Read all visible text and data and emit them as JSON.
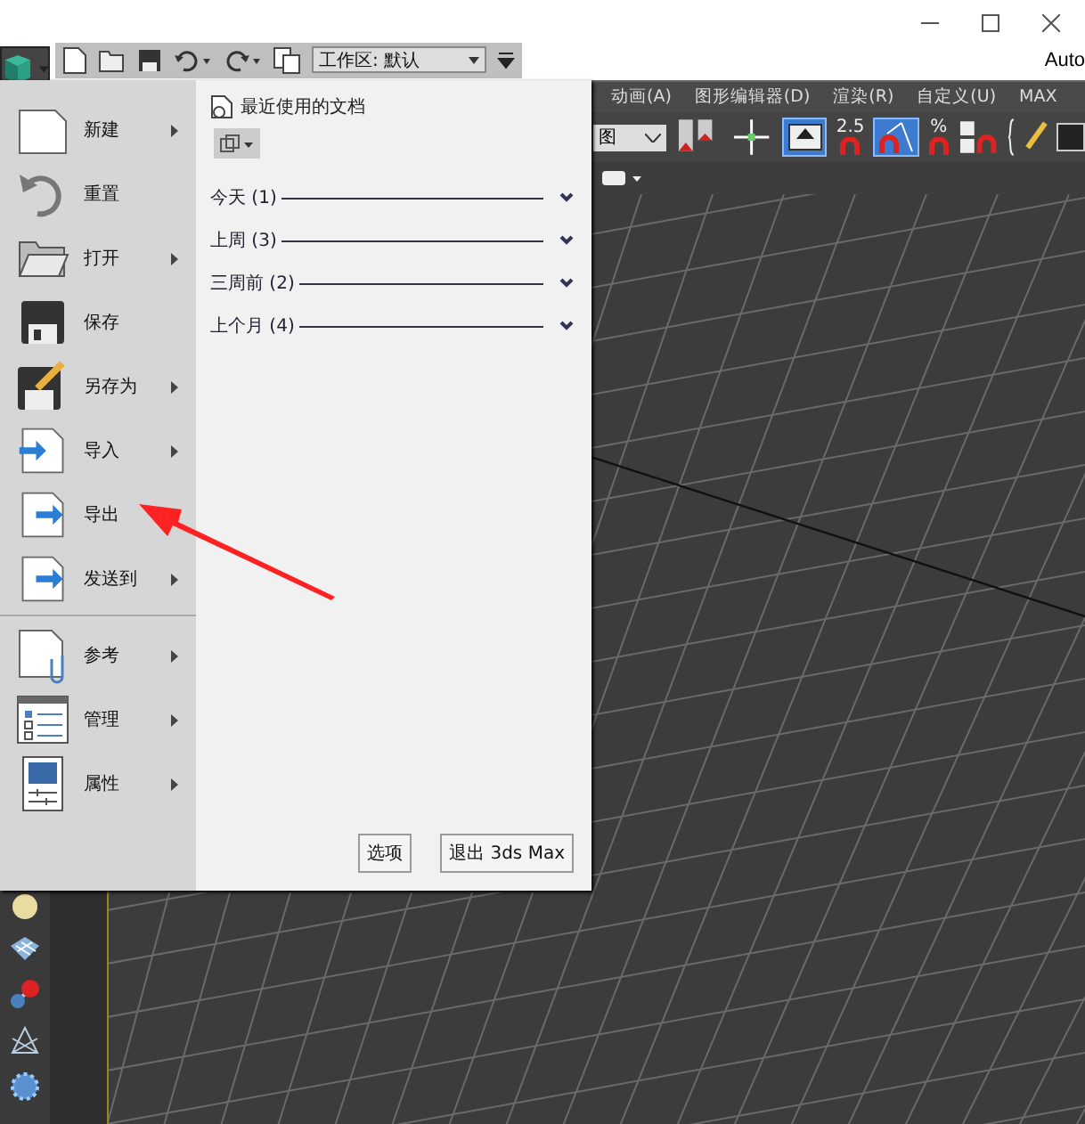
{
  "window": {
    "title": "Auto"
  },
  "quick_access": {
    "workspace_label": "工作区: 默认"
  },
  "menu_bar": [
    "动画(A)",
    "图形编辑器(D)",
    "渲染(R)",
    "自定义(U)",
    "MAX"
  ],
  "toolbar": {
    "view_dropdown": "图",
    "snap_angle_label": "2.5",
    "percent_snap_label": "%"
  },
  "app_menu": {
    "items": [
      {
        "kind": "new",
        "label": "新建",
        "submenu": true
      },
      {
        "kind": "reset",
        "label": "重置",
        "submenu": false
      },
      {
        "kind": "open",
        "label": "打开",
        "submenu": true
      },
      {
        "kind": "save",
        "label": "保存",
        "submenu": false
      },
      {
        "kind": "saveas",
        "label": "另存为",
        "submenu": true
      },
      {
        "kind": "import",
        "label": "导入",
        "submenu": true
      },
      {
        "kind": "export",
        "label": "导出",
        "submenu": false
      },
      {
        "kind": "send",
        "label": "发送到",
        "submenu": true
      },
      {
        "kind": "divider"
      },
      {
        "kind": "reference",
        "label": "参考",
        "submenu": true
      },
      {
        "kind": "manage",
        "label": "管理",
        "submenu": true
      },
      {
        "kind": "properties",
        "label": "属性",
        "submenu": true
      }
    ],
    "recent_title": "最近使用的文档",
    "recent_groups": [
      {
        "label": "今天 (1)",
        "expanded": false
      },
      {
        "label": "上周 (3)",
        "expanded": false
      },
      {
        "label": "三周前 (2)",
        "expanded": false
      },
      {
        "label": "上个月 (4)",
        "expanded": false
      }
    ],
    "buttons": [
      "选项",
      "退出 3ds Max"
    ]
  }
}
